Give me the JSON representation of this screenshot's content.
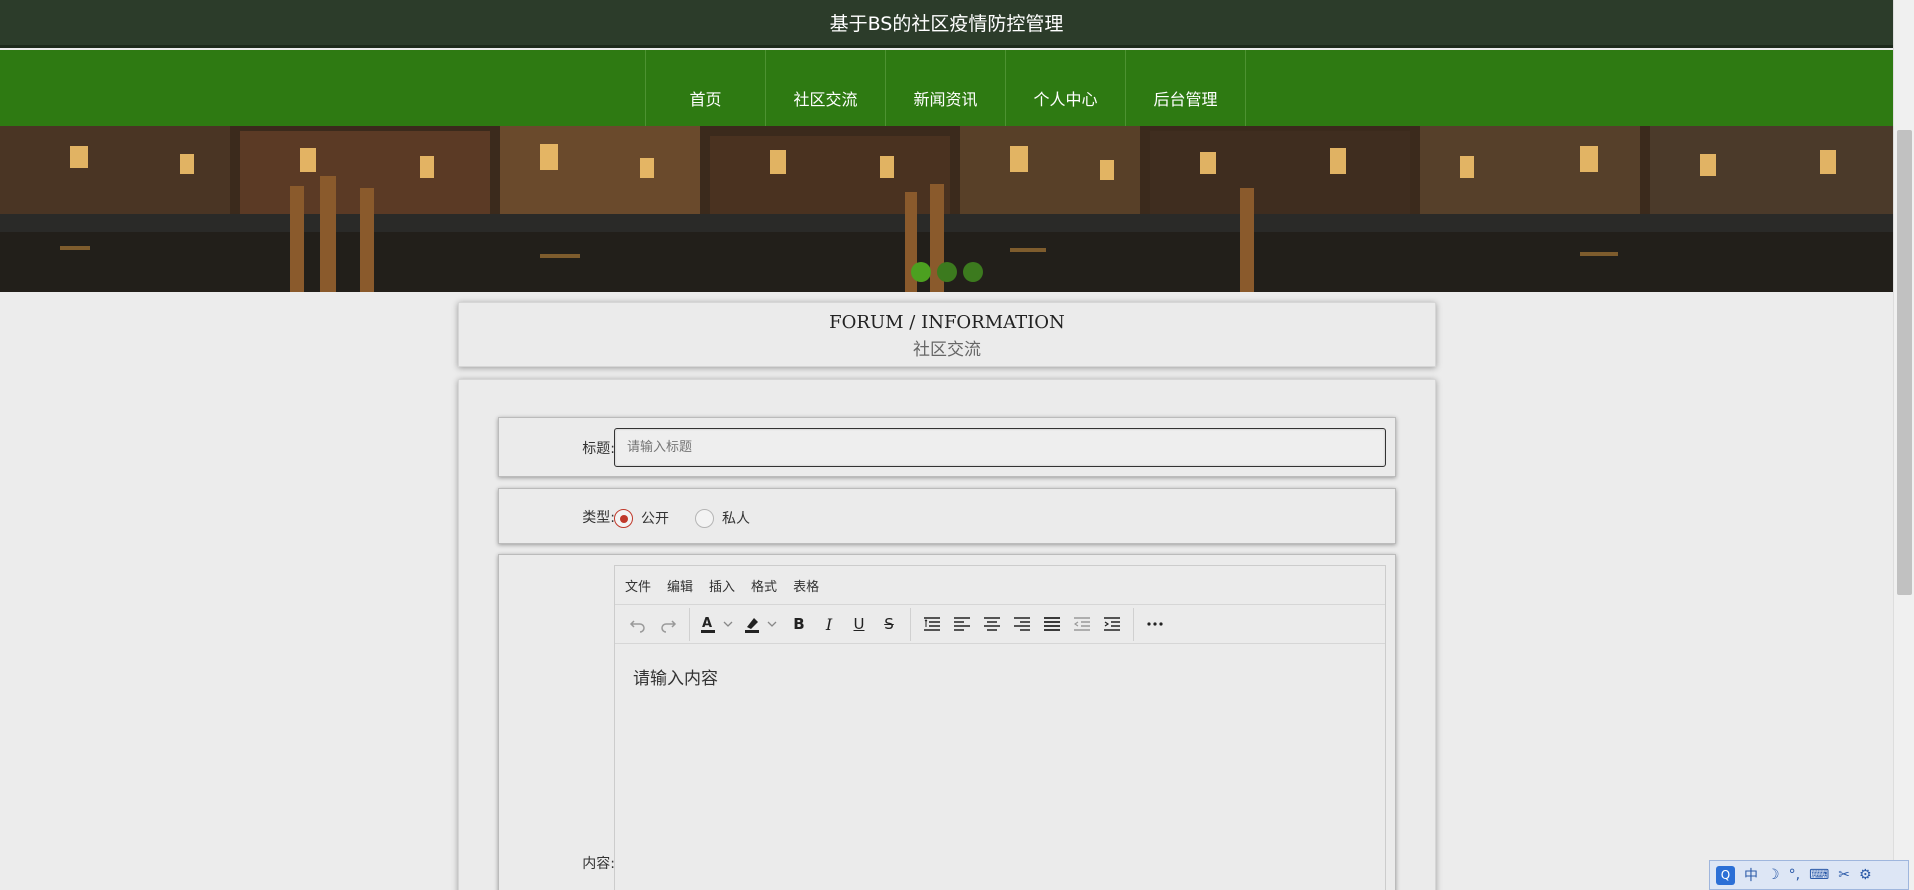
{
  "header": {
    "title": "基于BS的社区疫情防控管理"
  },
  "nav": {
    "items": [
      {
        "label": "首页"
      },
      {
        "label": "社区交流"
      },
      {
        "label": "新闻资讯"
      },
      {
        "label": "个人中心"
      },
      {
        "label": "后台管理"
      }
    ]
  },
  "carousel": {
    "slide_count": 3,
    "active_index": 0
  },
  "section": {
    "title_en": "FORUM / INFORMATION",
    "title_cn": "社区交流"
  },
  "form": {
    "title_label": "标题:",
    "title_placeholder": "请输入标题",
    "title_value": "",
    "type_label": "类型:",
    "type_options": [
      {
        "label": "公开",
        "selected": true
      },
      {
        "label": "私人",
        "selected": false
      }
    ],
    "content_label": "内容:",
    "editor": {
      "menus": [
        "文件",
        "编辑",
        "插入",
        "格式",
        "表格"
      ],
      "placeholder": "请输入内容",
      "toolbar": [
        "undo-icon",
        "redo-icon",
        "font-color-icon",
        "highlight-color-icon",
        "bold-icon",
        "italic-icon",
        "underline-icon",
        "strikethrough-icon",
        "line-height-icon",
        "align-left-icon",
        "align-center-icon",
        "align-right-icon",
        "align-justify-icon",
        "outdent-icon",
        "indent-icon",
        "more-icon"
      ]
    }
  },
  "ime_tray": {
    "items": [
      "中"
    ]
  },
  "colors": {
    "header_bg": "#2c3c2a",
    "nav_bg": "#2e7a12",
    "radio_accent": "#c0392b",
    "dot_active": "#4ca020"
  }
}
